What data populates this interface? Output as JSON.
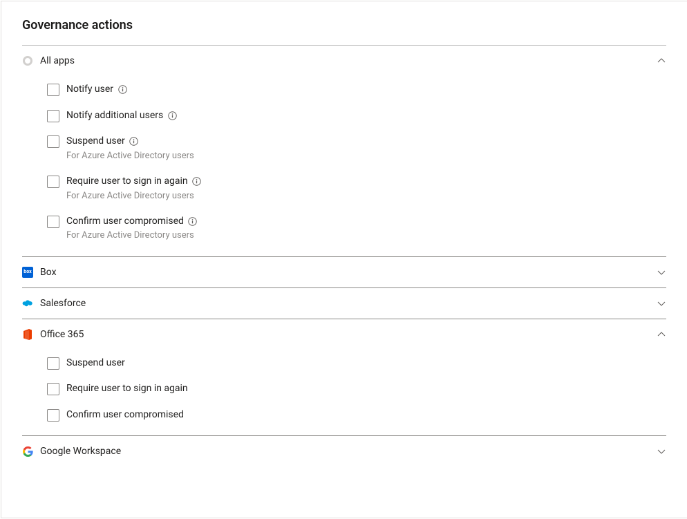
{
  "title": "Governance actions",
  "sections": [
    {
      "id": "all-apps",
      "label": "All apps",
      "expanded": true,
      "icon": "ring",
      "options": [
        {
          "label": "Notify user",
          "info": true
        },
        {
          "label": "Notify additional users",
          "info": true
        },
        {
          "label": "Suspend user",
          "info": true,
          "sub": "For Azure Active Directory users"
        },
        {
          "label": "Require user to sign in again",
          "info": true,
          "sub": "For Azure Active Directory users"
        },
        {
          "label": "Confirm user compromised",
          "info": true,
          "sub": "For Azure Active Directory users"
        }
      ]
    },
    {
      "id": "box",
      "label": "Box",
      "expanded": false,
      "icon": "box"
    },
    {
      "id": "salesforce",
      "label": "Salesforce",
      "expanded": false,
      "icon": "salesforce"
    },
    {
      "id": "office365",
      "label": "Office 365",
      "expanded": true,
      "icon": "office365",
      "options": [
        {
          "label": "Suspend user"
        },
        {
          "label": "Require user to sign in again"
        },
        {
          "label": "Confirm user compromised"
        }
      ]
    },
    {
      "id": "google-workspace",
      "label": "Google Workspace",
      "expanded": false,
      "icon": "google"
    }
  ]
}
